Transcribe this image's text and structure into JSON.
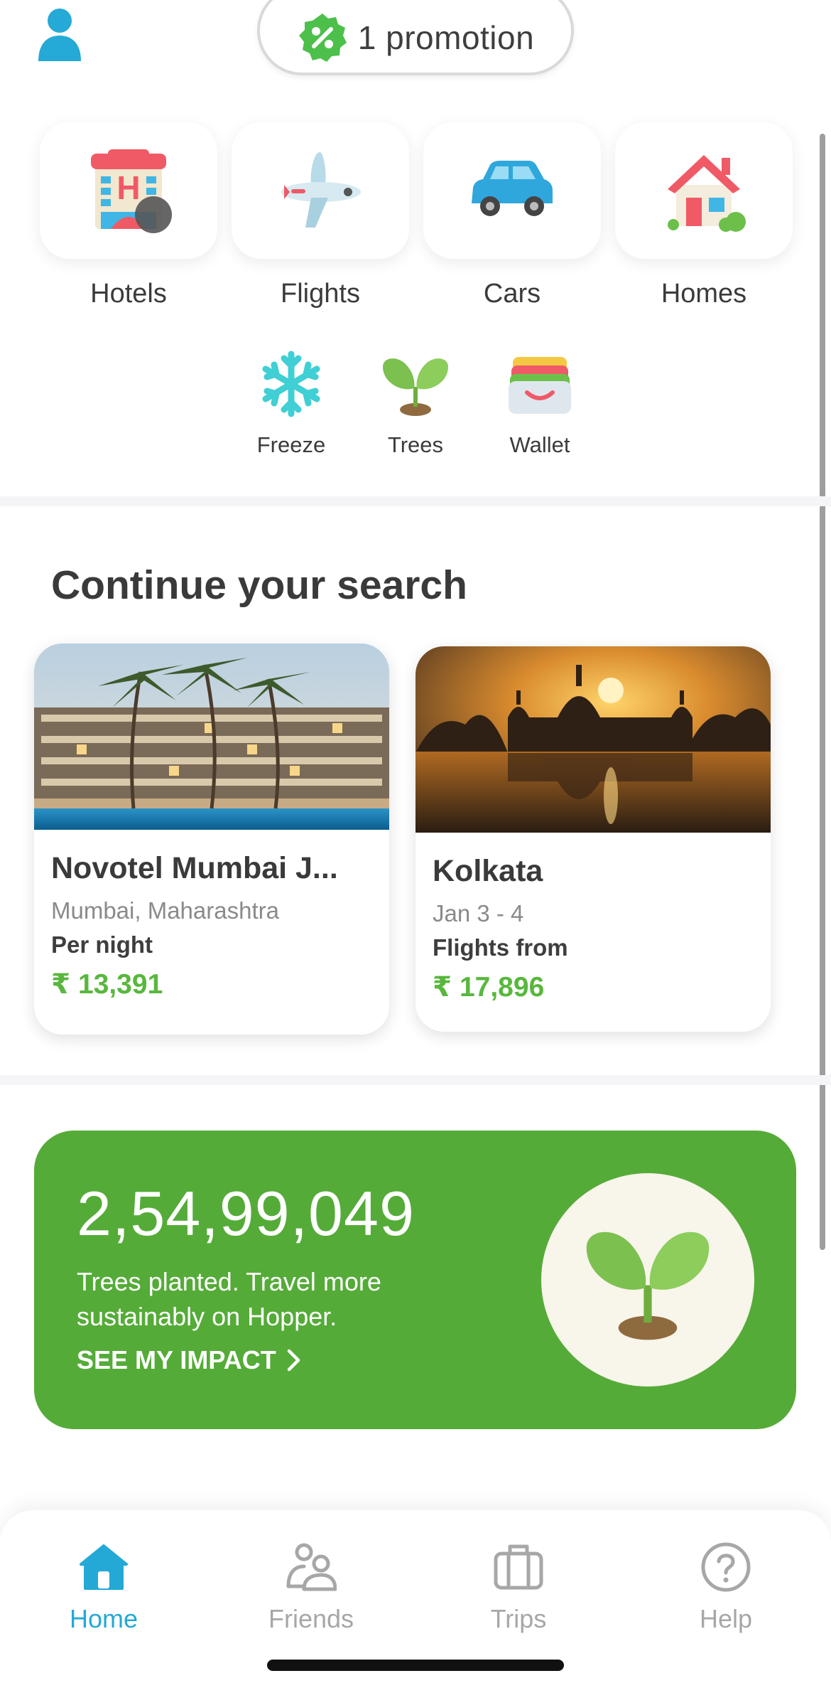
{
  "header": {
    "profile_icon": "person-icon",
    "promo_label": "1 promotion",
    "promo_icon": "percent-badge-icon"
  },
  "verticals": [
    {
      "label": "Hotels",
      "icon": "hotel-icon"
    },
    {
      "label": "Flights",
      "icon": "airplane-icon"
    },
    {
      "label": "Cars",
      "icon": "car-icon"
    },
    {
      "label": "Homes",
      "icon": "house-icon"
    }
  ],
  "quick_actions": [
    {
      "label": "Freeze",
      "icon": "snowflake-icon"
    },
    {
      "label": "Trees",
      "icon": "sprout-icon"
    },
    {
      "label": "Wallet",
      "icon": "wallet-icon"
    }
  ],
  "continue_search": {
    "title": "Continue your search",
    "cards": [
      {
        "title": "Novotel Mumbai J...",
        "subtitle": "Mumbai, Maharashtra",
        "caption": "Per night",
        "price": "₹ 13,391",
        "image": "hotel-pool-photo"
      },
      {
        "title": "Kolkata",
        "subtitle": "Jan 3 -  4",
        "caption": "Flights from",
        "price": "₹ 17,896",
        "image": "kolkata-monument-photo"
      }
    ]
  },
  "impact": {
    "number": "2,54,99,049",
    "text": "Trees planted. Travel more sustainably on Hopper.",
    "link_label": "SEE MY IMPACT",
    "icon": "sprout-icon"
  },
  "bottom_nav": [
    {
      "label": "Home",
      "icon": "home-icon",
      "active": true
    },
    {
      "label": "Friends",
      "icon": "friends-icon",
      "active": false
    },
    {
      "label": "Trips",
      "icon": "suitcase-icon",
      "active": false
    },
    {
      "label": "Help",
      "icon": "help-icon",
      "active": false
    }
  ],
  "colors": {
    "accent": "#24a9d6",
    "green": "#55ab38",
    "price_green": "#58b73d",
    "promo_green": "#4cc04a"
  }
}
